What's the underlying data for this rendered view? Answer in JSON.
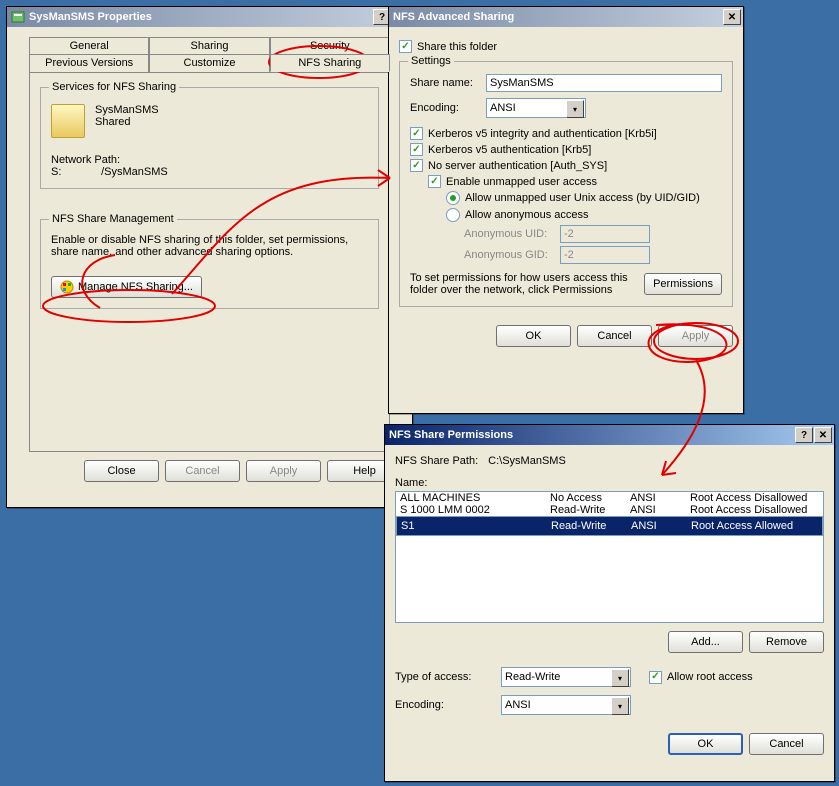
{
  "win1": {
    "title": "SysManSMS Properties",
    "tabs_row1": [
      "General",
      "Sharing",
      "Security"
    ],
    "tabs_row2": [
      "Previous Versions",
      "Customize",
      "NFS Sharing"
    ],
    "services_legend": "Services for NFS Sharing",
    "folder_name": "SysManSMS",
    "folder_state": "Shared",
    "netpath_label": "Network Path:",
    "netpath_value": "S:             /SysManSMS",
    "mgmt_legend": "NFS Share Management",
    "mgmt_text": "Enable or disable NFS sharing of this folder, set permissions, share name, and other advanced sharing options.",
    "manage_btn": "Manage NFS Sharing...",
    "close": "Close",
    "cancel": "Cancel",
    "apply": "Apply",
    "help": "Help"
  },
  "win2": {
    "title": "NFS Advanced Sharing",
    "share_folder": "Share this folder",
    "settings_legend": "Settings",
    "share_name_lbl": "Share name:",
    "share_name_val": "SysManSMS",
    "encoding_lbl": "Encoding:",
    "encoding_val": "ANSI",
    "krb5i": "Kerberos v5 integrity and authentication [Krb5i]",
    "krb5": "Kerberos v5 authentication [Krb5]",
    "authsys": "No server authentication [Auth_SYS]",
    "enable_unmapped": "Enable unmapped user access",
    "allow_unmapped": "Allow unmapped user Unix access (by UID/GID)",
    "allow_anon": "Allow anonymous access",
    "anon_uid_lbl": "Anonymous UID:",
    "anon_uid_val": "-2",
    "anon_gid_lbl": "Anonymous GID:",
    "anon_gid_val": "-2",
    "perm_text": "To set permissions for how users access this folder over the network, click Permissions",
    "perm_btn": "Permissions",
    "ok": "OK",
    "cancel": "Cancel",
    "apply": "Apply"
  },
  "win3": {
    "title": "NFS Share Permissions",
    "path_lbl": "NFS Share Path:",
    "path_val": "C:\\SysManSMS",
    "name_lbl": "Name:",
    "rows": [
      {
        "name": "ALL MACHINES",
        "access": "No Access",
        "enc": "ANSI",
        "root": "Root Access Disallowed"
      },
      {
        "name": "S 1000 LMM 0002",
        "access": "Read-Write",
        "enc": "ANSI",
        "root": "Root Access Disallowed"
      },
      {
        "name": "S1",
        "access": "Read-Write",
        "enc": "ANSI",
        "root": "Root Access Allowed"
      }
    ],
    "add": "Add...",
    "remove": "Remove",
    "type_lbl": "Type of access:",
    "type_val": "Read-Write",
    "allow_root": "Allow root access",
    "encoding_lbl": "Encoding:",
    "encoding_val": "ANSI",
    "ok": "OK",
    "cancel": "Cancel"
  }
}
